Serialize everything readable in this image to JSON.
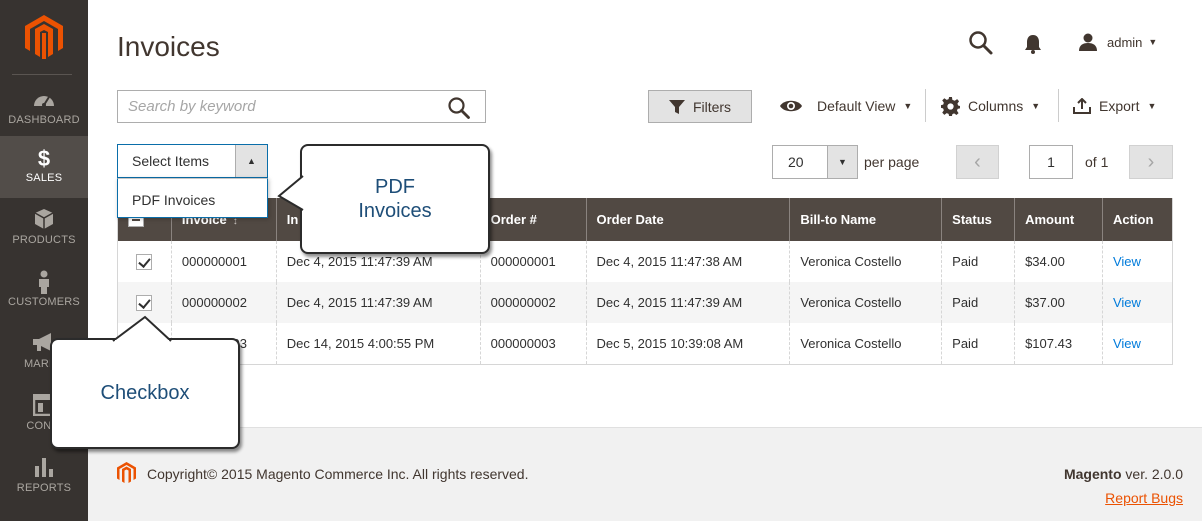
{
  "sidebar": {
    "items": [
      {
        "label": "DASHBOARD",
        "icon": "dashboard-icon"
      },
      {
        "label": "SALES",
        "icon": "dollar-icon"
      },
      {
        "label": "PRODUCTS",
        "icon": "box-icon"
      },
      {
        "label": "CUSTOMERS",
        "icon": "person-icon"
      },
      {
        "label": "MARKE",
        "icon": "megaphone-icon"
      },
      {
        "label": "CONTI",
        "icon": "layout-icon"
      },
      {
        "label": "REPORTS",
        "icon": "bar-chart-icon"
      }
    ],
    "colors": {
      "bg": "#373330",
      "active": "#524d49",
      "logo": "#eb5202"
    }
  },
  "header": {
    "title": "Invoices",
    "user": "admin"
  },
  "search": {
    "placeholder": "Search by keyword",
    "value": ""
  },
  "toolbar": {
    "filters_label": "Filters",
    "view_label": "Default View",
    "columns_label": "Columns",
    "export_label": "Export"
  },
  "mass_action": {
    "label": "Select Items",
    "options": [
      "PDF Invoices"
    ]
  },
  "pagination": {
    "per_page": "20",
    "per_page_label": "per page",
    "page": "1",
    "of_label": "of 1"
  },
  "grid": {
    "columns": [
      "Invoice",
      "In",
      "Order #",
      "Order Date",
      "Bill-to Name",
      "Status",
      "Amount",
      "Action"
    ],
    "rows": [
      {
        "checked": true,
        "invoice": "000000001",
        "invoice_date": "Dec 4, 2015 11:47:39 AM",
        "order": "000000001",
        "order_date": "Dec 4, 2015 11:47:38 AM",
        "bill_to": "Veronica Costello",
        "status": "Paid",
        "amount": "$34.00",
        "action": "View"
      },
      {
        "checked": true,
        "invoice": "000000002",
        "invoice_date": "Dec 4, 2015 11:47:39 AM",
        "order": "000000002",
        "order_date": "Dec 4, 2015 11:47:39 AM",
        "bill_to": "Veronica Costello",
        "status": "Paid",
        "amount": "$37.00",
        "action": "View"
      },
      {
        "checked": false,
        "invoice": "000000003",
        "invoice_date": "Dec 14, 2015 4:00:55 PM",
        "order": "000000003",
        "order_date": "Dec 5, 2015 10:39:08 AM",
        "bill_to": "Veronica Costello",
        "status": "Paid",
        "amount": "$107.43",
        "action": "View"
      }
    ]
  },
  "callouts": {
    "pdf_line1": "PDF",
    "pdf_line2": "Invoices",
    "checkbox": "Checkbox"
  },
  "footer": {
    "copyright": "Copyright© 2015 Magento Commerce Inc. All rights reserved.",
    "brand": "Magento",
    "version": " ver. 2.0.0",
    "report_bugs": "Report Bugs"
  }
}
